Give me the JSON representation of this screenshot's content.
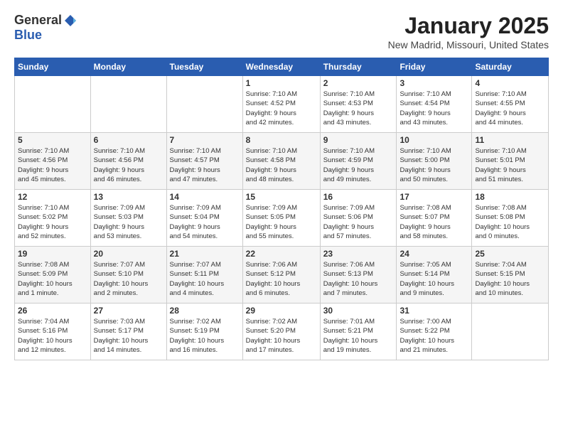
{
  "header": {
    "logo_general": "General",
    "logo_blue": "Blue",
    "title": "January 2025",
    "location": "New Madrid, Missouri, United States"
  },
  "weekdays": [
    "Sunday",
    "Monday",
    "Tuesday",
    "Wednesday",
    "Thursday",
    "Friday",
    "Saturday"
  ],
  "weeks": [
    [
      {
        "day": "",
        "info": ""
      },
      {
        "day": "",
        "info": ""
      },
      {
        "day": "",
        "info": ""
      },
      {
        "day": "1",
        "info": "Sunrise: 7:10 AM\nSunset: 4:52 PM\nDaylight: 9 hours\nand 42 minutes."
      },
      {
        "day": "2",
        "info": "Sunrise: 7:10 AM\nSunset: 4:53 PM\nDaylight: 9 hours\nand 43 minutes."
      },
      {
        "day": "3",
        "info": "Sunrise: 7:10 AM\nSunset: 4:54 PM\nDaylight: 9 hours\nand 43 minutes."
      },
      {
        "day": "4",
        "info": "Sunrise: 7:10 AM\nSunset: 4:55 PM\nDaylight: 9 hours\nand 44 minutes."
      }
    ],
    [
      {
        "day": "5",
        "info": "Sunrise: 7:10 AM\nSunset: 4:56 PM\nDaylight: 9 hours\nand 45 minutes."
      },
      {
        "day": "6",
        "info": "Sunrise: 7:10 AM\nSunset: 4:56 PM\nDaylight: 9 hours\nand 46 minutes."
      },
      {
        "day": "7",
        "info": "Sunrise: 7:10 AM\nSunset: 4:57 PM\nDaylight: 9 hours\nand 47 minutes."
      },
      {
        "day": "8",
        "info": "Sunrise: 7:10 AM\nSunset: 4:58 PM\nDaylight: 9 hours\nand 48 minutes."
      },
      {
        "day": "9",
        "info": "Sunrise: 7:10 AM\nSunset: 4:59 PM\nDaylight: 9 hours\nand 49 minutes."
      },
      {
        "day": "10",
        "info": "Sunrise: 7:10 AM\nSunset: 5:00 PM\nDaylight: 9 hours\nand 50 minutes."
      },
      {
        "day": "11",
        "info": "Sunrise: 7:10 AM\nSunset: 5:01 PM\nDaylight: 9 hours\nand 51 minutes."
      }
    ],
    [
      {
        "day": "12",
        "info": "Sunrise: 7:10 AM\nSunset: 5:02 PM\nDaylight: 9 hours\nand 52 minutes."
      },
      {
        "day": "13",
        "info": "Sunrise: 7:09 AM\nSunset: 5:03 PM\nDaylight: 9 hours\nand 53 minutes."
      },
      {
        "day": "14",
        "info": "Sunrise: 7:09 AM\nSunset: 5:04 PM\nDaylight: 9 hours\nand 54 minutes."
      },
      {
        "day": "15",
        "info": "Sunrise: 7:09 AM\nSunset: 5:05 PM\nDaylight: 9 hours\nand 55 minutes."
      },
      {
        "day": "16",
        "info": "Sunrise: 7:09 AM\nSunset: 5:06 PM\nDaylight: 9 hours\nand 57 minutes."
      },
      {
        "day": "17",
        "info": "Sunrise: 7:08 AM\nSunset: 5:07 PM\nDaylight: 9 hours\nand 58 minutes."
      },
      {
        "day": "18",
        "info": "Sunrise: 7:08 AM\nSunset: 5:08 PM\nDaylight: 10 hours\nand 0 minutes."
      }
    ],
    [
      {
        "day": "19",
        "info": "Sunrise: 7:08 AM\nSunset: 5:09 PM\nDaylight: 10 hours\nand 1 minute."
      },
      {
        "day": "20",
        "info": "Sunrise: 7:07 AM\nSunset: 5:10 PM\nDaylight: 10 hours\nand 2 minutes."
      },
      {
        "day": "21",
        "info": "Sunrise: 7:07 AM\nSunset: 5:11 PM\nDaylight: 10 hours\nand 4 minutes."
      },
      {
        "day": "22",
        "info": "Sunrise: 7:06 AM\nSunset: 5:12 PM\nDaylight: 10 hours\nand 6 minutes."
      },
      {
        "day": "23",
        "info": "Sunrise: 7:06 AM\nSunset: 5:13 PM\nDaylight: 10 hours\nand 7 minutes."
      },
      {
        "day": "24",
        "info": "Sunrise: 7:05 AM\nSunset: 5:14 PM\nDaylight: 10 hours\nand 9 minutes."
      },
      {
        "day": "25",
        "info": "Sunrise: 7:04 AM\nSunset: 5:15 PM\nDaylight: 10 hours\nand 10 minutes."
      }
    ],
    [
      {
        "day": "26",
        "info": "Sunrise: 7:04 AM\nSunset: 5:16 PM\nDaylight: 10 hours\nand 12 minutes."
      },
      {
        "day": "27",
        "info": "Sunrise: 7:03 AM\nSunset: 5:17 PM\nDaylight: 10 hours\nand 14 minutes."
      },
      {
        "day": "28",
        "info": "Sunrise: 7:02 AM\nSunset: 5:19 PM\nDaylight: 10 hours\nand 16 minutes."
      },
      {
        "day": "29",
        "info": "Sunrise: 7:02 AM\nSunset: 5:20 PM\nDaylight: 10 hours\nand 17 minutes."
      },
      {
        "day": "30",
        "info": "Sunrise: 7:01 AM\nSunset: 5:21 PM\nDaylight: 10 hours\nand 19 minutes."
      },
      {
        "day": "31",
        "info": "Sunrise: 7:00 AM\nSunset: 5:22 PM\nDaylight: 10 hours\nand 21 minutes."
      },
      {
        "day": "",
        "info": ""
      }
    ]
  ]
}
